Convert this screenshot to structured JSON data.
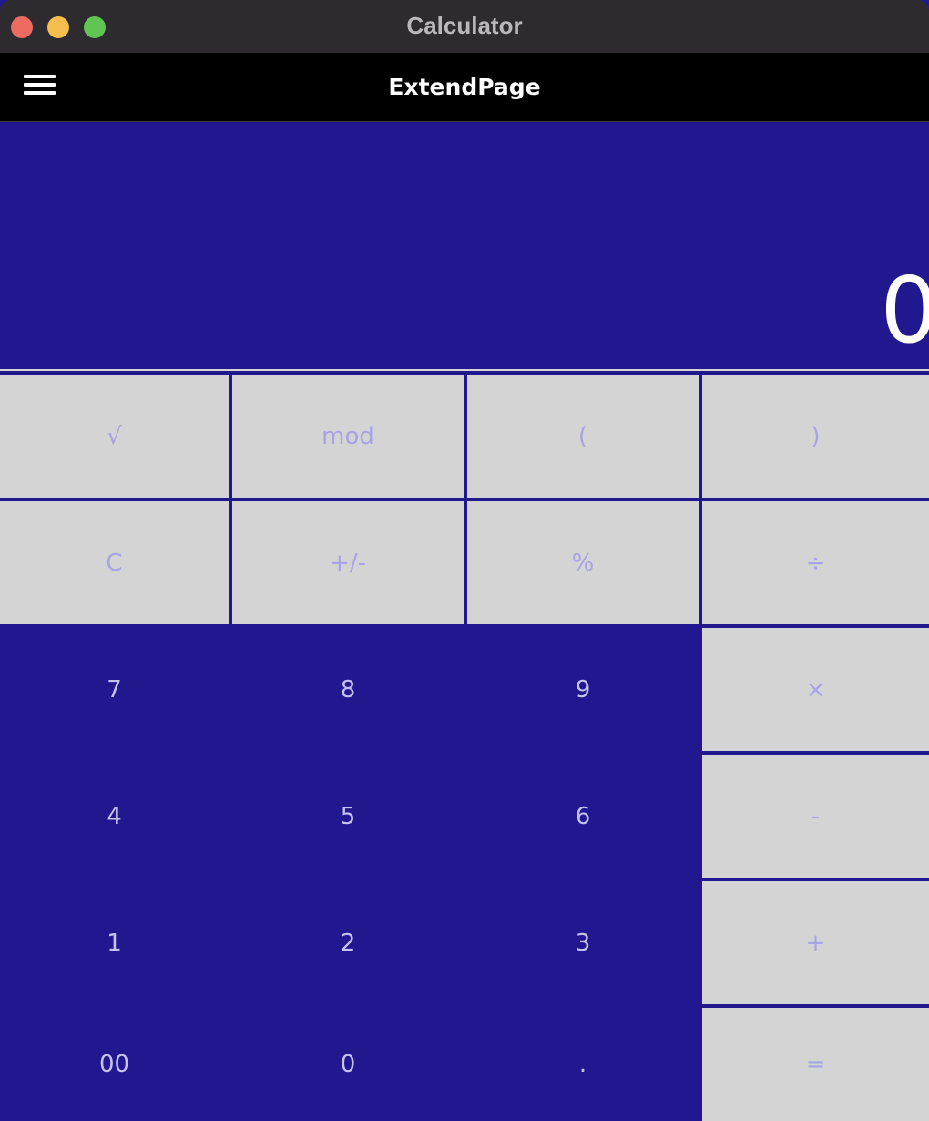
{
  "window": {
    "title": "Calculator"
  },
  "appbar": {
    "title": "ExtendPage",
    "menu_icon": "hamburger-menu-icon"
  },
  "display": {
    "value": "0"
  },
  "keypad": {
    "sqrt": "√",
    "mod": "mod",
    "open_paren": "(",
    "close_paren": ")",
    "clear": "C",
    "sign": "+/-",
    "percent": "%",
    "divide": "÷",
    "seven": "7",
    "eight": "8",
    "nine": "9",
    "multiply": "×",
    "four": "4",
    "five": "5",
    "six": "6",
    "minus": "-",
    "one": "1",
    "two": "2",
    "three": "3",
    "plus": "+",
    "double_zero": "00",
    "zero": "0",
    "decimal": ".",
    "equals": "="
  },
  "colors": {
    "accent": "#21188f",
    "operator_key": "#d4d4d4",
    "operator_text": "#a8a3e6",
    "digit_text": "#c5c1f1",
    "appbar": "#000000",
    "titlebar": "#2d2b30"
  }
}
